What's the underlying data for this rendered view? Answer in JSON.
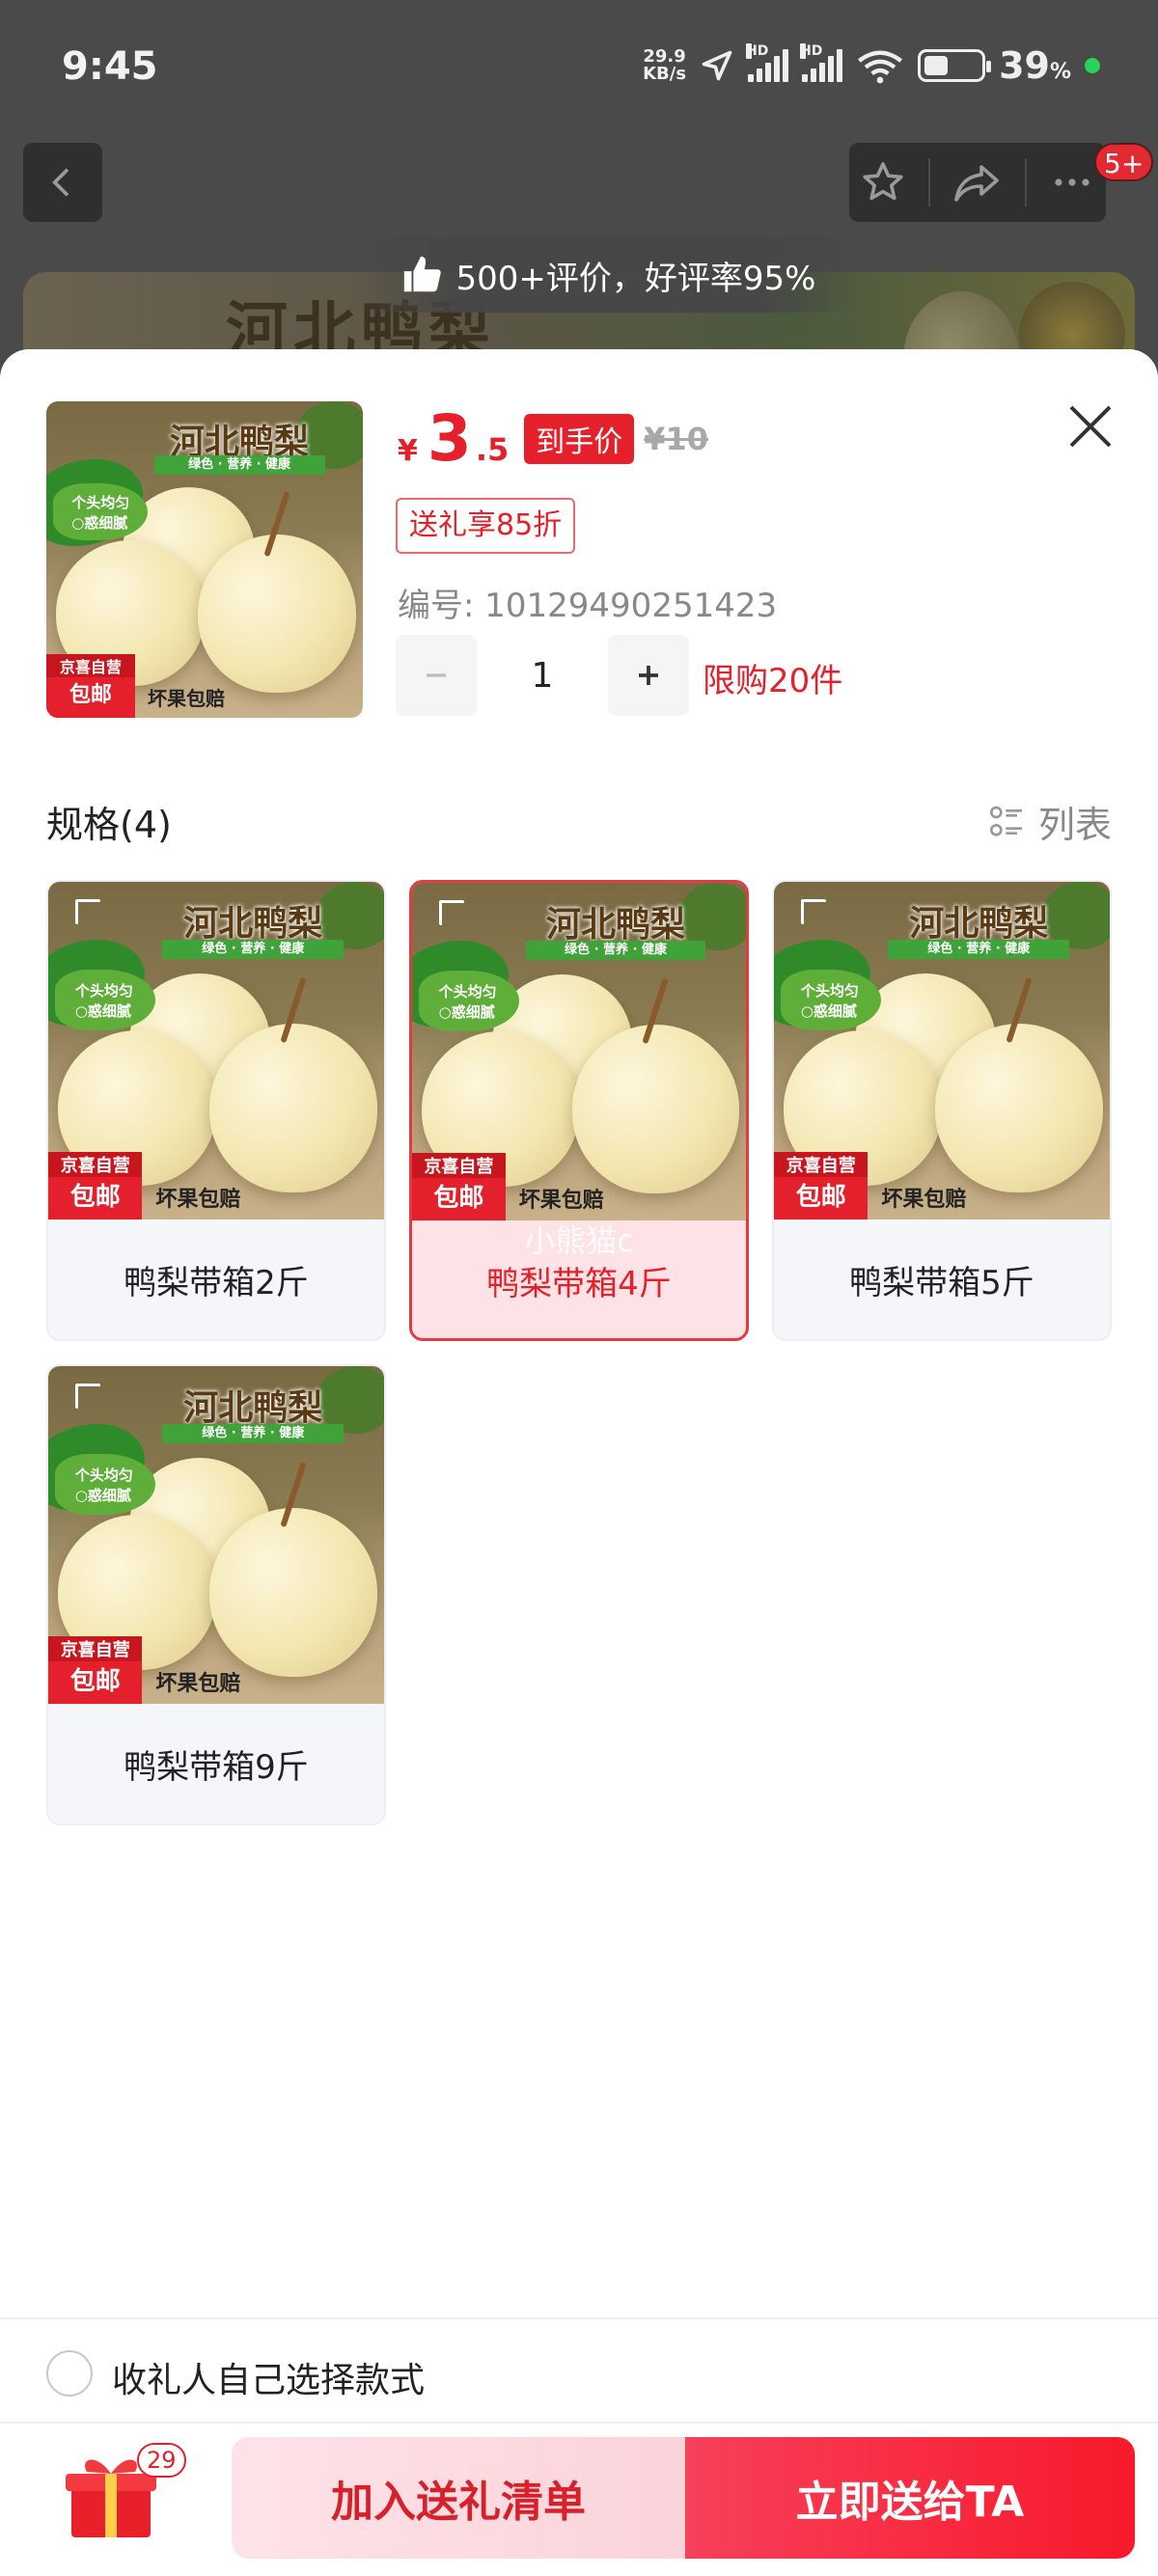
{
  "status_bar": {
    "time": "9:45",
    "net_speed_value": "29.9",
    "net_speed_unit": "KB/s",
    "hd_label": "HD",
    "battery_percent": "39",
    "battery_unit": "%"
  },
  "background_page": {
    "message_badge": "5+",
    "review_text": "500+评价，好评率95%",
    "hero_text": "河北鸭梨"
  },
  "product": {
    "price_symbol": "¥",
    "price_int": "3",
    "price_dec": ".5",
    "price_tag": "到手价",
    "original_price": "¥10",
    "gift_discount": "送礼享85折",
    "sku_number": "编号: 10129490251423",
    "quantity": "1",
    "purchase_limit": "限购20件"
  },
  "product_image": {
    "title": "河北鸭梨",
    "subtitle": "绿色 · 营养 · 健康",
    "bubble_line1": "个头均匀",
    "bubble_line2": "○惑细腻",
    "badge_line1": "京喜自营",
    "badge_line2": "包邮",
    "bottom_text": "坏果包赔"
  },
  "spec": {
    "title": "规格(4)",
    "list_toggle": "列表",
    "watermark": "小熊猫c",
    "variants": [
      {
        "label": "鸭梨带箱2斤",
        "selected": false
      },
      {
        "label": "鸭梨带箱4斤",
        "selected": true
      },
      {
        "label": "鸭梨带箱5斤",
        "selected": false
      },
      {
        "label": "鸭梨带箱9斤",
        "selected": false
      }
    ]
  },
  "bottom": {
    "recipient_label": "收礼人自己选择款式",
    "gift_count": "29",
    "add_button": "加入送礼清单",
    "send_button": "立即送给TA"
  },
  "colors": {
    "accent_red": "#e5202b",
    "selected_bg": "#fde3e6",
    "overlay_dark": "#4a4a4a"
  }
}
